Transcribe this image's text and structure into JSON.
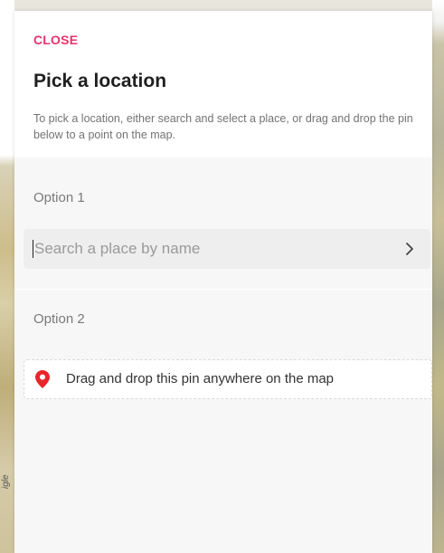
{
  "dialog": {
    "close_label": "CLOSE",
    "title": "Pick a location",
    "description": "To pick a location, either search and select a place, or drag and drop the pin below to a point on the map."
  },
  "option1": {
    "label": "Option 1",
    "search_placeholder": "Search a place by name",
    "submit_icon": "chevron-right-icon"
  },
  "option2": {
    "label": "Option 2",
    "pin_icon": "map-pin-icon",
    "pin_text": "Drag and drop this pin anywhere on the map"
  },
  "map": {
    "edge_label": "igle"
  },
  "colors": {
    "accent": "#e8336c",
    "pin": "#e8252b"
  }
}
